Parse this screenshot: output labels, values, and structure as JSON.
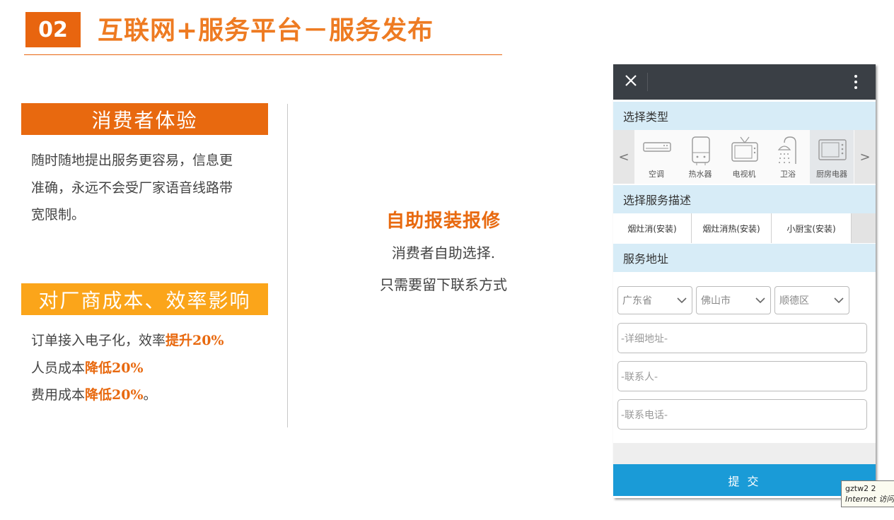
{
  "header": {
    "number": "02",
    "title": "互联网+服务平台－服务发布"
  },
  "left": {
    "consumer": {
      "heading": "消费者体验",
      "lines": [
        "随时随地提出服务更容易，信息更",
        "准确，永远不会受厂家语音线路带",
        "宽限制。"
      ]
    },
    "vendor": {
      "heading": "对厂商成本、效率影响",
      "line1_prefix": "订单接入电子化，效率",
      "line1_hl": "提升20%",
      "line2_prefix": "人员成本",
      "line2_hl": "降低20%",
      "line3_prefix": "费用成本",
      "line3_hl": "降低20%",
      "line3_suffix": "。"
    }
  },
  "middle": {
    "title": "自助报装报修",
    "line1": "消费者自助选择.",
    "line2": "只需要留下联系方式"
  },
  "phone": {
    "section_type": "选择类型",
    "categories": [
      "空调",
      "热水器",
      "电视机",
      "卫浴",
      "厨房电器"
    ],
    "arrow_left": "<",
    "arrow_right": ">",
    "section_desc": "选择服务描述",
    "descriptions": [
      "烟灶消(安装)",
      "烟灶消热(安装)",
      "小厨宝(安装)"
    ],
    "section_addr": "服务地址",
    "province": "广东省",
    "city": "佛山市",
    "district": "顺德区",
    "placeholder_address": "-详细地址-",
    "placeholder_contact": "-联系人-",
    "placeholder_phone": "-联系电话-",
    "submit": "提 交"
  },
  "tooltip": {
    "line1": "gztw2  2",
    "line2": "Internet 访问"
  },
  "colors": {
    "orange": "#e8690f",
    "amber": "#fba51a",
    "blue": "#1a9bd7",
    "section_bg": "#d7ecf7"
  }
}
